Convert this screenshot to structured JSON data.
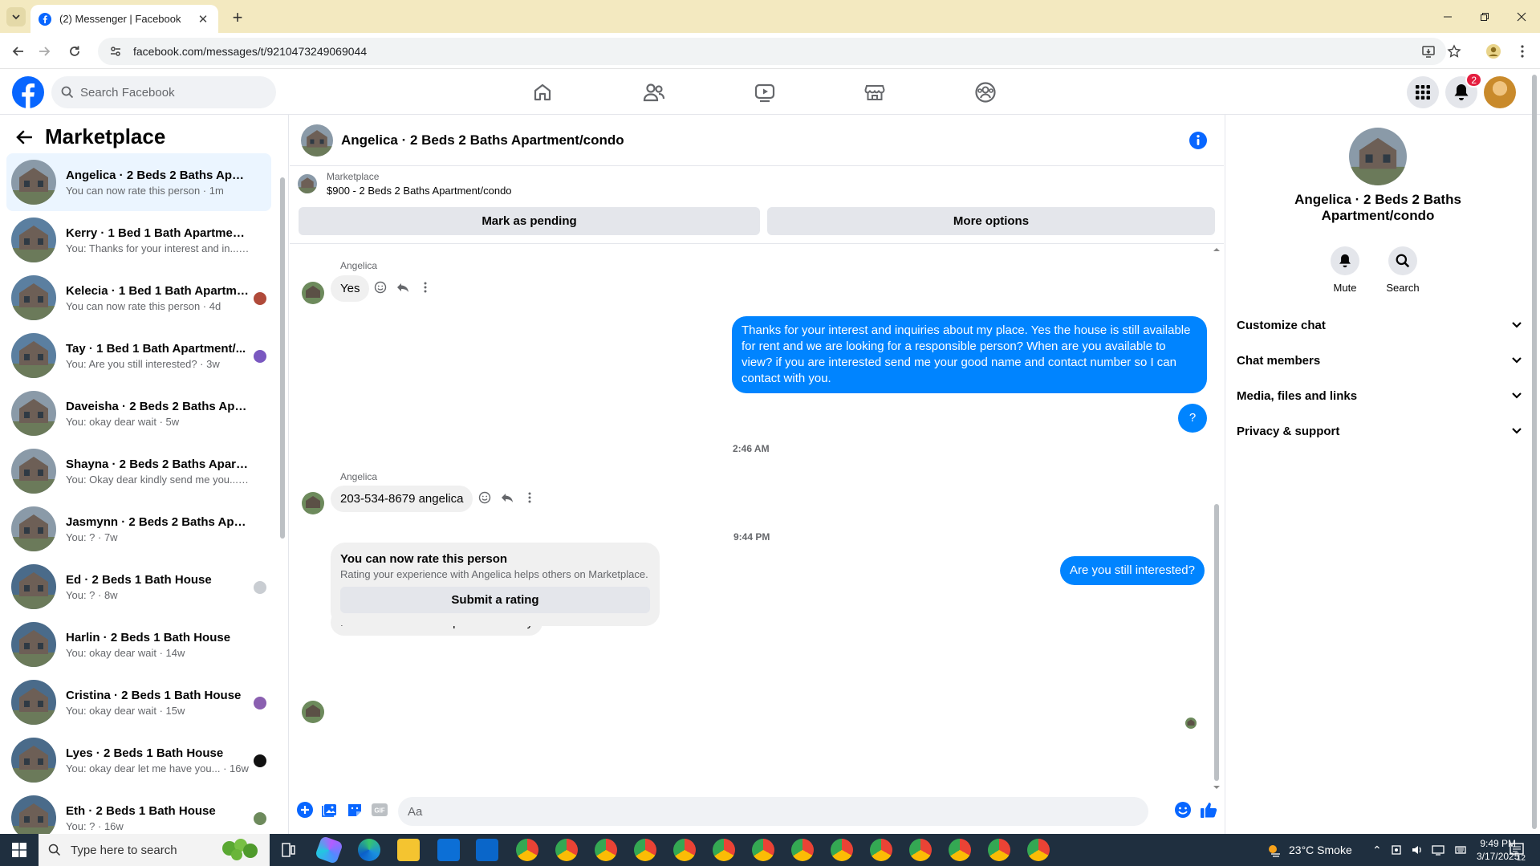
{
  "browser": {
    "tab_title": "(2) Messenger | Facebook",
    "url": "facebook.com/messages/t/9210473249069044"
  },
  "header": {
    "search_placeholder": "Search Facebook",
    "notifications_count": "2",
    "nav_icons": [
      "home-icon",
      "friends-icon",
      "watch-icon",
      "marketplace-icon",
      "groups-icon"
    ]
  },
  "sidebar": {
    "title": "Marketplace",
    "conversations": [
      {
        "name": "Angelica · 2 Beds 2 Baths Apart...",
        "preview": "You can now rate this person · 1m"
      },
      {
        "name": "Kerry · 1 Bed 1 Bath Apartment/c...",
        "preview": "You: Thanks for your interest and in... · 3d"
      },
      {
        "name": "Kelecia · 1 Bed 1 Bath Apartment...",
        "preview": "You can now rate this person · 4d"
      },
      {
        "name": "Tay · 1 Bed 1 Bath Apartment/...",
        "preview": "You: Are you still interested? · 3w"
      },
      {
        "name": "Daveisha · 2 Beds 2 Baths Apa...",
        "preview": "You: okay dear wait · 5w"
      },
      {
        "name": "Shayna · 2 Beds 2 Baths Apartm...",
        "preview": "You: Okay dear kindly send me you... · 7w"
      },
      {
        "name": "Jasmynn · 2 Beds 2 Baths Apart...",
        "preview": "You: ? · 7w"
      },
      {
        "name": "Ed · 2 Beds 1 Bath House",
        "preview": "You: ? · 8w"
      },
      {
        "name": "Harlin · 2 Beds 1 Bath House",
        "preview": "You: okay dear wait · 14w"
      },
      {
        "name": "Cristina · 2 Beds 1 Bath House",
        "preview": "You: okay dear wait · 15w"
      },
      {
        "name": "Lyes · 2 Beds 1 Bath House",
        "preview": "You: okay dear let me have you... · 16w"
      },
      {
        "name": "Eth · 2 Beds 1 Bath House",
        "preview": "You: ? · 16w"
      }
    ]
  },
  "chat": {
    "title": "Angelica · 2 Beds 2 Baths Apartment/condo",
    "listing_label": "Marketplace",
    "listing_detail": "$900 - 2 Beds 2 Baths Apartment/condo",
    "mark_pending": "Mark as pending",
    "more_options": "More options",
    "sender_name": "Angelica",
    "msg_yes": "Yes",
    "msg_out_long": "Thanks for your interest and inquiries about my place. Yes the house is still available for rent and we are looking for a responsible person? When are you available to view? if you are interested send me your good name and contact number so I can contact with you.",
    "msg_out_q": "?",
    "time_1": "2:46 AM",
    "msg_phone": "203-534-8679 angelica",
    "time_2": "9:44 PM",
    "msg_out_still": "Are you still interested?",
    "msg_today": "Hi Yes can I see it department today",
    "rate_title": "You can now rate this person",
    "rate_sub": "Rating your experience with Angelica helps others on Marketplace.",
    "rate_button": "Submit a rating",
    "composer_placeholder": "Aa"
  },
  "details": {
    "name": "Angelica · 2 Beds 2 Baths Apartment/condo",
    "mute": "Mute",
    "search": "Search",
    "sections": [
      "Customize chat",
      "Chat members",
      "Media, files and links",
      "Privacy & support"
    ]
  },
  "taskbar": {
    "search_placeholder": "Type here to search",
    "weather": "23°C  Smoke",
    "time": "9:49 PM",
    "date": "3/17/2025",
    "notif_count": "12"
  },
  "colors": {
    "fb_blue": "#0866ff",
    "messenger_blue": "#0084ff",
    "active_row": "#ebf5ff",
    "chrome_tabstrip": "#f3e9c0"
  }
}
